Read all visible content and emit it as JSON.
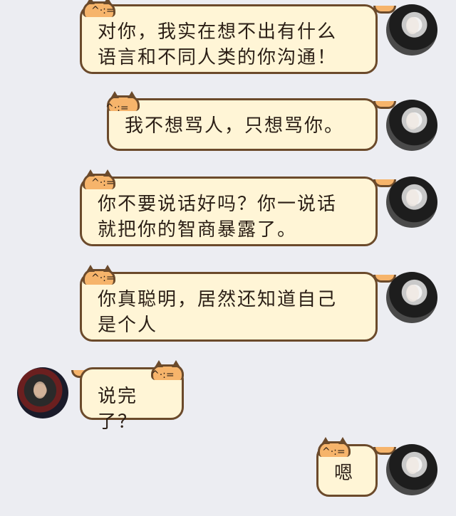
{
  "messages": [
    {
      "side": "right",
      "text": "对你，我实在想不出有什么\n语言和不同人类的你沟通！"
    },
    {
      "side": "right",
      "text": "我不想骂人，只想骂你。"
    },
    {
      "side": "right",
      "text": "你不要说话好吗？你一说话\n就把你的智商暴露了。"
    },
    {
      "side": "right",
      "text": "你真聪明，居然还知道自己\n是个人"
    },
    {
      "side": "left",
      "text": "说完了？"
    },
    {
      "side": "right",
      "text": "嗯"
    }
  ],
  "decor": {
    "cat_ears_icon": "cat-bubble-decoration",
    "whisker_mark": "^·:="
  }
}
